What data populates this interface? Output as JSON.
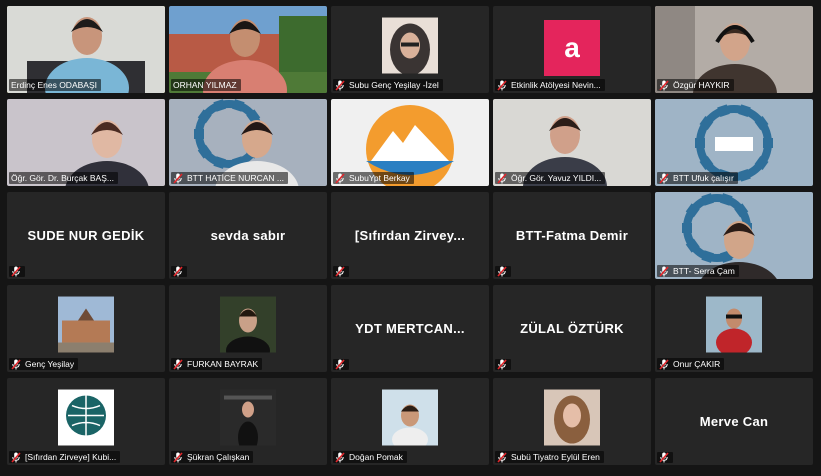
{
  "tiles": [
    {
      "name": "Erdinç Enes ODABAŞI",
      "muted": false,
      "active": true,
      "kind": "video",
      "scene": "person-white"
    },
    {
      "name": "ORHAN YILMAZ",
      "muted": false,
      "kind": "video",
      "scene": "outdoor-building"
    },
    {
      "name": "Subu Genç Yeşilay -İzel",
      "muted": true,
      "kind": "thumb",
      "scene": "portrait-hijab"
    },
    {
      "name": "Etkinlik Atölyesi Nevin...",
      "muted": true,
      "kind": "letter",
      "letter": "a"
    },
    {
      "name": "Özgür HAYKIR",
      "muted": true,
      "kind": "video",
      "scene": "person-headphones"
    },
    {
      "name": "Öğr. Gör. Dr. Burçak BAŞ...",
      "muted": false,
      "kind": "video",
      "scene": "person-woman"
    },
    {
      "name": "BTT HATİCE NURCAN ...",
      "muted": true,
      "kind": "video",
      "scene": "btt-woman"
    },
    {
      "name": "SubuYpt Berkay",
      "muted": true,
      "kind": "video",
      "scene": "mountain-logo"
    },
    {
      "name": "Öğr. Gör. Yavuz YILDI...",
      "muted": true,
      "kind": "video",
      "scene": "person-man"
    },
    {
      "name": "BTT Ufuk çalışır",
      "muted": true,
      "kind": "video",
      "scene": "btt-logo"
    },
    {
      "name": "",
      "label": "SUDE NUR GEDİK",
      "muted": true,
      "kind": "text"
    },
    {
      "name": "",
      "label": "sevda sabır",
      "muted": true,
      "kind": "text"
    },
    {
      "name": "",
      "label": "[Sıfırdan  Zirvey...",
      "muted": true,
      "kind": "text"
    },
    {
      "name": "",
      "label": "BTT-Fatma Demir",
      "muted": true,
      "kind": "text"
    },
    {
      "name": "BTT- Serra Çam",
      "muted": true,
      "kind": "video",
      "scene": "btt-woman2"
    },
    {
      "name": "Genç Yeşilay",
      "muted": true,
      "kind": "thumb",
      "scene": "building"
    },
    {
      "name": "FURKAN BAYRAK",
      "muted": true,
      "kind": "thumb",
      "scene": "portrait-man-dark"
    },
    {
      "name": "",
      "label": "YDT  MERTCAN...",
      "muted": true,
      "kind": "text"
    },
    {
      "name": "",
      "label": "ZÜLAL ÖZTÜRK",
      "muted": true,
      "kind": "text"
    },
    {
      "name": "Onur ÇAKIR",
      "muted": true,
      "kind": "thumb",
      "scene": "portrait-red"
    },
    {
      "name": "[Sıfırdan Zirveye] Kubi...",
      "muted": true,
      "kind": "thumb",
      "scene": "globe-logo"
    },
    {
      "name": "Şükran Çalışkan",
      "muted": true,
      "kind": "thumb",
      "scene": "portrait-woman-dark"
    },
    {
      "name": "Doğan Pomak",
      "muted": true,
      "kind": "thumb",
      "scene": "portrait-man-light"
    },
    {
      "name": "Subü Tiyatro Eylül Eren",
      "muted": true,
      "kind": "thumb",
      "scene": "portrait-woman-light"
    },
    {
      "name": "",
      "label": "Merve Can",
      "muted": true,
      "kind": "text"
    }
  ],
  "colors": {
    "active_border": "#c9d74a",
    "mute_red": "#e0262b",
    "tile_bg": "#262626"
  }
}
